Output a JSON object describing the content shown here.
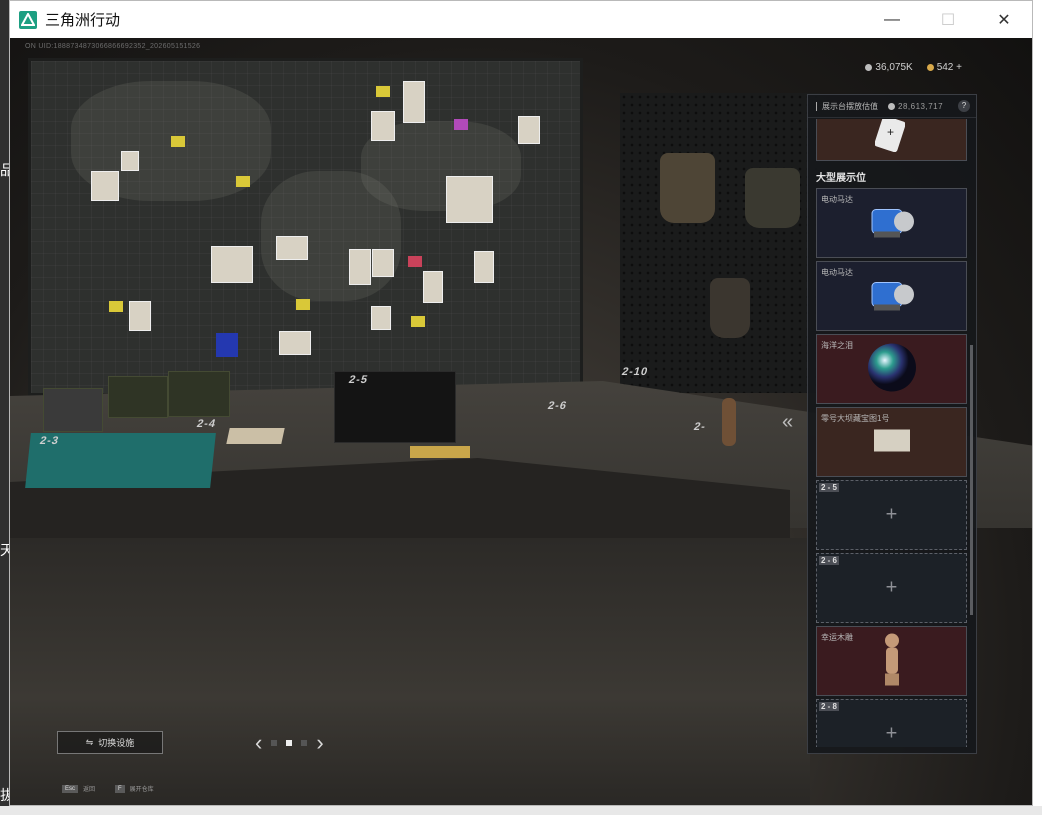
{
  "window": {
    "title": "三角洲行动",
    "minimize_glyph": "—",
    "maximize_glyph": "☐",
    "close_glyph": "✕"
  },
  "game": {
    "uid_text": "ON UID:1888734873066866692352_202605151526",
    "currency": {
      "primary": "36,075K",
      "secondary": "542",
      "add_glyph": "+"
    },
    "table_slots": [
      "2-3",
      "2-4",
      "2-5",
      "2-6",
      "2-10",
      "2-"
    ],
    "panel": {
      "header_label": "展示台摆放估值",
      "header_value": "28,613,717",
      "help_glyph": "?",
      "section_title": "大型展示位",
      "cards": [
        {
          "name": "电动马达",
          "kind": "motor",
          "style": "blue"
        },
        {
          "name": "电动马达",
          "kind": "motor",
          "style": "blue"
        },
        {
          "name": "海洋之泪",
          "kind": "orb",
          "style": "red"
        },
        {
          "name": "零号大坝藏宝图1号",
          "kind": "map",
          "style": "brown"
        },
        {
          "slot": "2 - 5",
          "style": "empty"
        },
        {
          "slot": "2 - 6",
          "style": "empty"
        },
        {
          "name": "幸运木雕",
          "kind": "statue",
          "style": "red"
        },
        {
          "slot": "2 - 8",
          "style": "empty"
        }
      ],
      "plus_glyph": "+",
      "collapse_glyph": "«"
    },
    "switch_button_label": "切换设施",
    "pager": {
      "prev": "‹",
      "next": "›"
    },
    "hints": [
      {
        "key": "Esc",
        "label": "返回"
      },
      {
        "key": "F",
        "label": "展开仓库"
      }
    ]
  },
  "colors": {
    "accent": "#1d9f82",
    "panel_bg": "#16181b",
    "card_blue": "#1c1f2e",
    "card_red": "#3a1b1f",
    "card_brown": "#3a2620"
  }
}
